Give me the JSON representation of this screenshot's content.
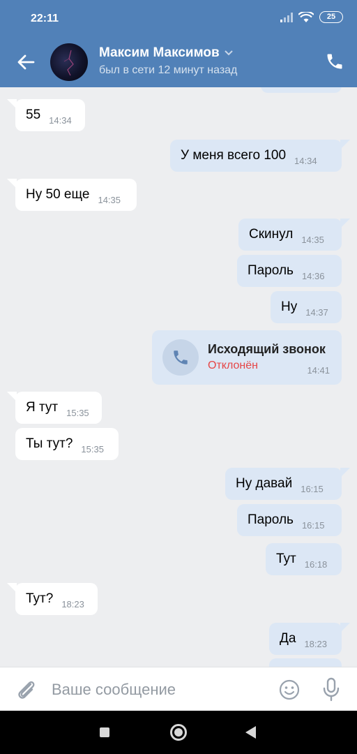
{
  "status_bar": {
    "time": "22:11",
    "battery": "25"
  },
  "header": {
    "contact_name": "Максим Максимов",
    "contact_status": "был в сети 12 минут назад"
  },
  "messages": [
    {
      "dir": "in",
      "text": "55",
      "time": "14:34"
    },
    {
      "dir": "out",
      "text": "У меня всего 100",
      "time": "14:34"
    },
    {
      "dir": "in",
      "text": "Ну 50 еще",
      "time": "14:35"
    },
    {
      "dir": "out",
      "text": "Скинул",
      "time": "14:35"
    },
    {
      "dir": "out",
      "text": "Пароль",
      "time": "14:36"
    },
    {
      "dir": "out",
      "text": "Ну",
      "time": "14:37"
    },
    {
      "dir": "in",
      "text": "Я тут",
      "time": "15:35"
    },
    {
      "dir": "in",
      "text": "Ты тут?",
      "time": "15:35"
    },
    {
      "dir": "out",
      "text": "Ну давай",
      "time": "16:15"
    },
    {
      "dir": "out",
      "text": "Пароль",
      "time": "16:15"
    },
    {
      "dir": "out",
      "text": "Тут",
      "time": "16:18"
    },
    {
      "dir": "in",
      "text": "Тут?",
      "time": "18:23"
    },
    {
      "dir": "out",
      "text": "Да",
      "time": "18:23"
    }
  ],
  "call": {
    "title": "Исходящий звонок",
    "status": "Отклонён",
    "time": "14:41"
  },
  "composer": {
    "placeholder": "Ваше сообщение"
  },
  "colors": {
    "header": "#5181b8",
    "outgoing_bubble": "#dce7f5",
    "incoming_bubble": "#ffffff",
    "declined": "#e64646"
  }
}
